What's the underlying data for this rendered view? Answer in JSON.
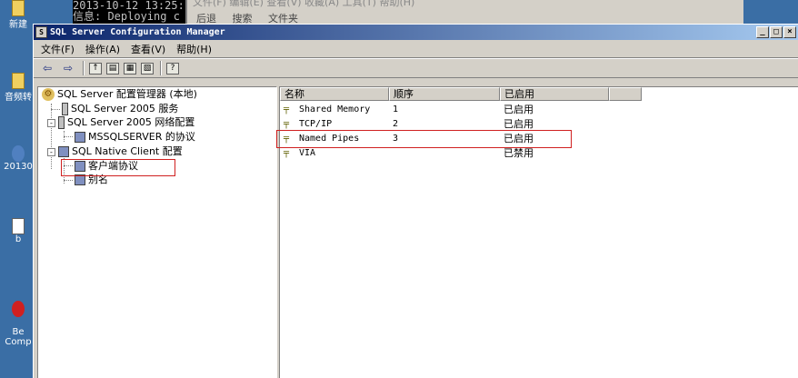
{
  "desktop": {
    "icons": [
      {
        "label": "新建",
        "icon": "folder-icon"
      },
      {
        "label": "音频转",
        "icon": "folder-icon"
      },
      {
        "label": "20130",
        "icon": "app-icon"
      },
      {
        "label": "b",
        "icon": "document-icon"
      },
      {
        "label": "Be\nComp",
        "icon": "app-icon"
      }
    ]
  },
  "background_console": {
    "lines": [
      "2013-10-12 13:25:",
      "信息: Deploying c"
    ]
  },
  "background_explorer": {
    "menu": "文件(F)  编辑(E)  查看(V)  收藏(A)  工具(T)  帮助(H)",
    "toolbar": [
      "后退",
      "搜索",
      "文件夹"
    ]
  },
  "window": {
    "title": "SQL Server Configuration Manager",
    "buttons": {
      "minimize": "_",
      "maximize": "□",
      "close": "×"
    }
  },
  "menubar": {
    "items": [
      "文件(F)",
      "操作(A)",
      "查看(V)",
      "帮助(H)"
    ]
  },
  "tree": {
    "root": "SQL Server 配置管理器 (本地)",
    "items": [
      {
        "label": "SQL Server 2005 服务"
      },
      {
        "label": "SQL Server 2005 网络配置",
        "expander": "-"
      },
      {
        "label": "MSSQLSERVER 的协议"
      },
      {
        "label": "SQL Native Client 配置",
        "expander": "-"
      },
      {
        "label": "客户端协议"
      },
      {
        "label": "别名"
      }
    ]
  },
  "list": {
    "columns": [
      "名称",
      "顺序",
      "已启用"
    ],
    "rows": [
      {
        "name": "Shared Memory",
        "order": "1",
        "enabled": "已启用"
      },
      {
        "name": "TCP/IP",
        "order": "2",
        "enabled": "已启用"
      },
      {
        "name": "Named Pipes",
        "order": "3",
        "enabled": "已启用"
      },
      {
        "name": "VIA",
        "order": "",
        "enabled": "已禁用"
      }
    ]
  },
  "colors": {
    "title_gradient_start": "#0a246a",
    "title_gradient_end": "#a6caf0",
    "highlight_box": "#d02020",
    "desktop": "#3a6ea5"
  }
}
